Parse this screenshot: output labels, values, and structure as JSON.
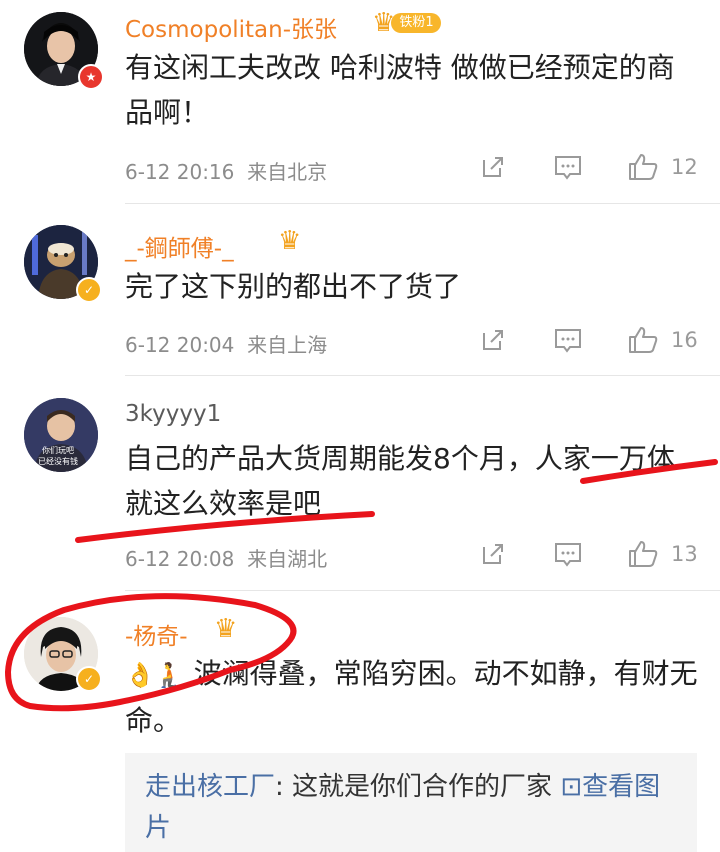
{
  "comments": [
    {
      "username": "Cosmopolitan-张张",
      "fan_badge": "铁粉1",
      "text": "有这闲工夫改改 哈利波特 做做已经预定的商品啊！",
      "time": "6-12 20:16",
      "location": "来自北京",
      "likes": "12"
    },
    {
      "username": "_-鋼師傅-_",
      "text": "完了这下别的都出不了货了",
      "time": "6-12 20:04",
      "location": "来自上海",
      "likes": "16"
    },
    {
      "username": "3kyyyy1",
      "avatar_caption_1": "你们玩吧",
      "avatar_caption_2": "已经没有钱",
      "text": "自己的产品大货周期能发8个月，人家一万体就这么效率是吧",
      "time": "6-12 20:08",
      "location": "来自湖北",
      "likes": "13"
    },
    {
      "username": "-杨奇-",
      "emoji": "👌🧎",
      "text": "波澜得叠，常陷穷困。动不如静，有财无命。",
      "reply": {
        "user": "走出核工厂",
        "text": ": 这就是你们合作的厂家",
        "link": "查看图片"
      }
    }
  ],
  "colors": {
    "username_orange": "#f08027",
    "link_blue": "#4a6fa5",
    "annotation_red": "#e8141b",
    "meta_gray": "#8c8c8c"
  },
  "icons": [
    "share-icon",
    "comment-icon",
    "like-icon",
    "verified-badge-icon",
    "crown-icon"
  ]
}
